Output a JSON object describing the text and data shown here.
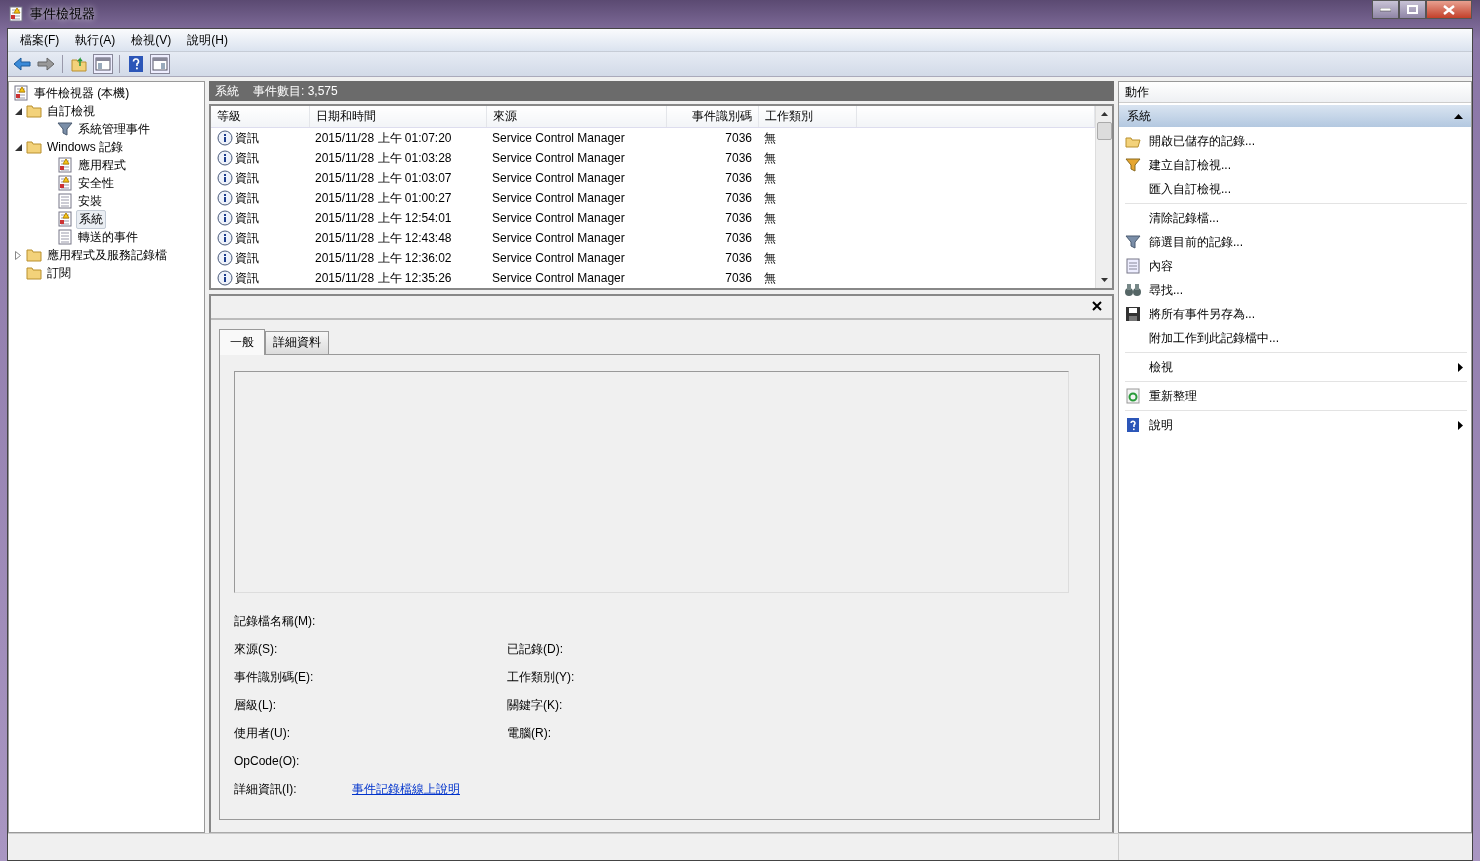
{
  "window": {
    "title": "事件檢視器"
  },
  "menu": [
    "檔案(F)",
    "執行(A)",
    "檢視(V)",
    "說明(H)"
  ],
  "tree": [
    {
      "label": "事件檢視器 (本機)",
      "selected": false,
      "children": [
        {
          "label": "自訂檢視",
          "selected": false,
          "expanded": true,
          "children": [
            {
              "label": "系統管理事件",
              "selected": false
            }
          ]
        },
        {
          "label": "Windows 記錄",
          "selected": false,
          "expanded": true,
          "children": [
            {
              "label": "應用程式",
              "selected": false
            },
            {
              "label": "安全性",
              "selected": false
            },
            {
              "label": "安裝",
              "selected": false
            },
            {
              "label": "系統",
              "selected": true
            },
            {
              "label": "轉送的事件",
              "selected": false
            }
          ]
        },
        {
          "label": "應用程式及服務記錄檔",
          "selected": false,
          "expanded": false
        },
        {
          "label": "訂閱",
          "selected": false
        }
      ]
    }
  ],
  "log_header": {
    "name": "系統",
    "count": "事件數目: 3,575"
  },
  "table": {
    "columns": [
      "等級",
      "日期和時間",
      "來源",
      "事件識別碼",
      "工作類別"
    ],
    "rows": [
      {
        "level": "資訊",
        "date": "2015/11/28 上午 01:07:20",
        "source": "Service Control Manager",
        "event_id": "7036",
        "category": "無"
      },
      {
        "level": "資訊",
        "date": "2015/11/28 上午 01:03:28",
        "source": "Service Control Manager",
        "event_id": "7036",
        "category": "無"
      },
      {
        "level": "資訊",
        "date": "2015/11/28 上午 01:03:07",
        "source": "Service Control Manager",
        "event_id": "7036",
        "category": "無"
      },
      {
        "level": "資訊",
        "date": "2015/11/28 上午 01:00:27",
        "source": "Service Control Manager",
        "event_id": "7036",
        "category": "無"
      },
      {
        "level": "資訊",
        "date": "2015/11/28 上午 12:54:01",
        "source": "Service Control Manager",
        "event_id": "7036",
        "category": "無"
      },
      {
        "level": "資訊",
        "date": "2015/11/28 上午 12:43:48",
        "source": "Service Control Manager",
        "event_id": "7036",
        "category": "無"
      },
      {
        "level": "資訊",
        "date": "2015/11/28 上午 12:36:02",
        "source": "Service Control Manager",
        "event_id": "7036",
        "category": "無"
      },
      {
        "level": "資訊",
        "date": "2015/11/28 上午 12:35:26",
        "source": "Service Control Manager",
        "event_id": "7036",
        "category": "無"
      }
    ]
  },
  "detail": {
    "tabs": [
      {
        "label": "一般",
        "selected": true
      },
      {
        "label": "詳細資料",
        "selected": false
      }
    ],
    "fields": [
      {
        "left": "記錄檔名稱(M):"
      },
      {
        "left": "來源(S):",
        "right": "已記錄(D):"
      },
      {
        "left": "事件識別碼(E):",
        "right": "工作類別(Y):"
      },
      {
        "left": "層級(L):",
        "right": "關鍵字(K):"
      },
      {
        "left": "使用者(U):",
        "right": "電腦(R):"
      },
      {
        "left": "OpCode(O):"
      },
      {
        "left": "詳細資訊(I):",
        "link": "事件記錄檔線上說明"
      }
    ]
  },
  "actions": {
    "title": "動作",
    "section": {
      "label": "系統",
      "expanded": true
    },
    "groups": [
      [
        {
          "label": "開啟已儲存的記錄...",
          "submenu": false
        },
        {
          "label": "建立自訂檢視...",
          "submenu": false
        },
        {
          "label": "匯入自訂檢視...",
          "submenu": false
        }
      ],
      [
        {
          "label": "清除記錄檔...",
          "submenu": false
        },
        {
          "label": "篩選目前的記錄...",
          "submenu": false
        },
        {
          "label": "內容",
          "submenu": false
        },
        {
          "label": "尋找...",
          "submenu": false
        },
        {
          "label": "將所有事件另存為...",
          "submenu": false
        },
        {
          "label": "附加工作到此記錄檔中...",
          "submenu": false
        }
      ],
      [
        {
          "label": "檢視",
          "submenu": true
        }
      ],
      [
        {
          "label": "重新整理",
          "submenu": false
        }
      ],
      [
        {
          "label": "說明",
          "submenu": true
        }
      ]
    ]
  }
}
